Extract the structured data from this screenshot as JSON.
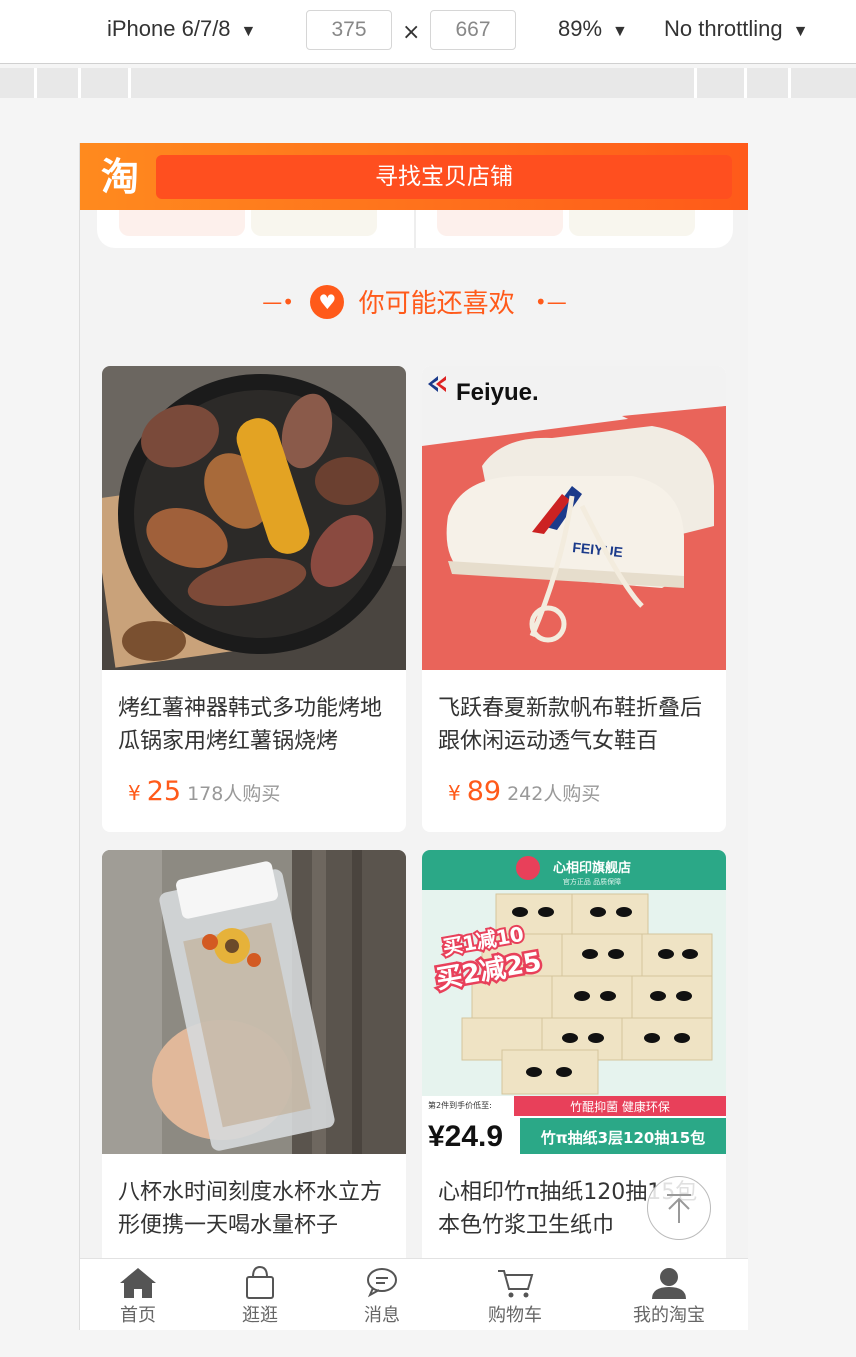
{
  "devtools": {
    "device": "iPhone 6/7/8",
    "width": "375",
    "height": "667",
    "times": "×",
    "zoom": "89%",
    "throttling": "No throttling"
  },
  "header": {
    "logo_text": "淘",
    "search_label": "寻找宝贝店铺"
  },
  "section": {
    "title": "你可能还喜欢"
  },
  "products": [
    {
      "name": "烤红薯神器韩式多功能烤地瓜锅家用烤红薯锅烧烤",
      "currency": "¥",
      "price": "25",
      "sold": "178人购买"
    },
    {
      "name": "飞跃春夏新款帆布鞋折叠后跟休闲运动透气女鞋百",
      "currency": "¥",
      "price": "89",
      "sold": "242人购买"
    },
    {
      "name": "八杯水时间刻度水杯水立方形便携一天喝水量杯子",
      "currency": "",
      "price": "",
      "sold": ""
    },
    {
      "name": "心相印竹π抽纸120抽15包本色竹浆卫生纸巾",
      "currency": "",
      "price": "",
      "sold": ""
    }
  ],
  "image_texts": {
    "feiyue_brand": "Feiyue.",
    "feiyue_shoe": "FEIYUE",
    "tissue_store": "心相印旗舰店",
    "tissue_sub": "官方正品 品质保障",
    "tissue_promo1": "买1减10",
    "tissue_promo2": "买2减25",
    "tissue_price_note": "第2件到手价低至:",
    "tissue_price": "¥24.9",
    "tissue_green": "竹醌抑菌 健康环保",
    "tissue_banner": "竹π抽纸3层120抽15包"
  },
  "tabbar": [
    {
      "label": "首页",
      "icon": "home-icon"
    },
    {
      "label": "逛逛",
      "icon": "shopping-bag-icon"
    },
    {
      "label": "消息",
      "icon": "chat-bubble-icon"
    },
    {
      "label": "购物车",
      "icon": "cart-icon"
    },
    {
      "label": "我的淘宝",
      "icon": "user-icon"
    }
  ],
  "colors": {
    "brand_orange": "#ff5a1a",
    "header_gradient_start": "#ff8a1e",
    "price_color": "#ff5a1a"
  }
}
